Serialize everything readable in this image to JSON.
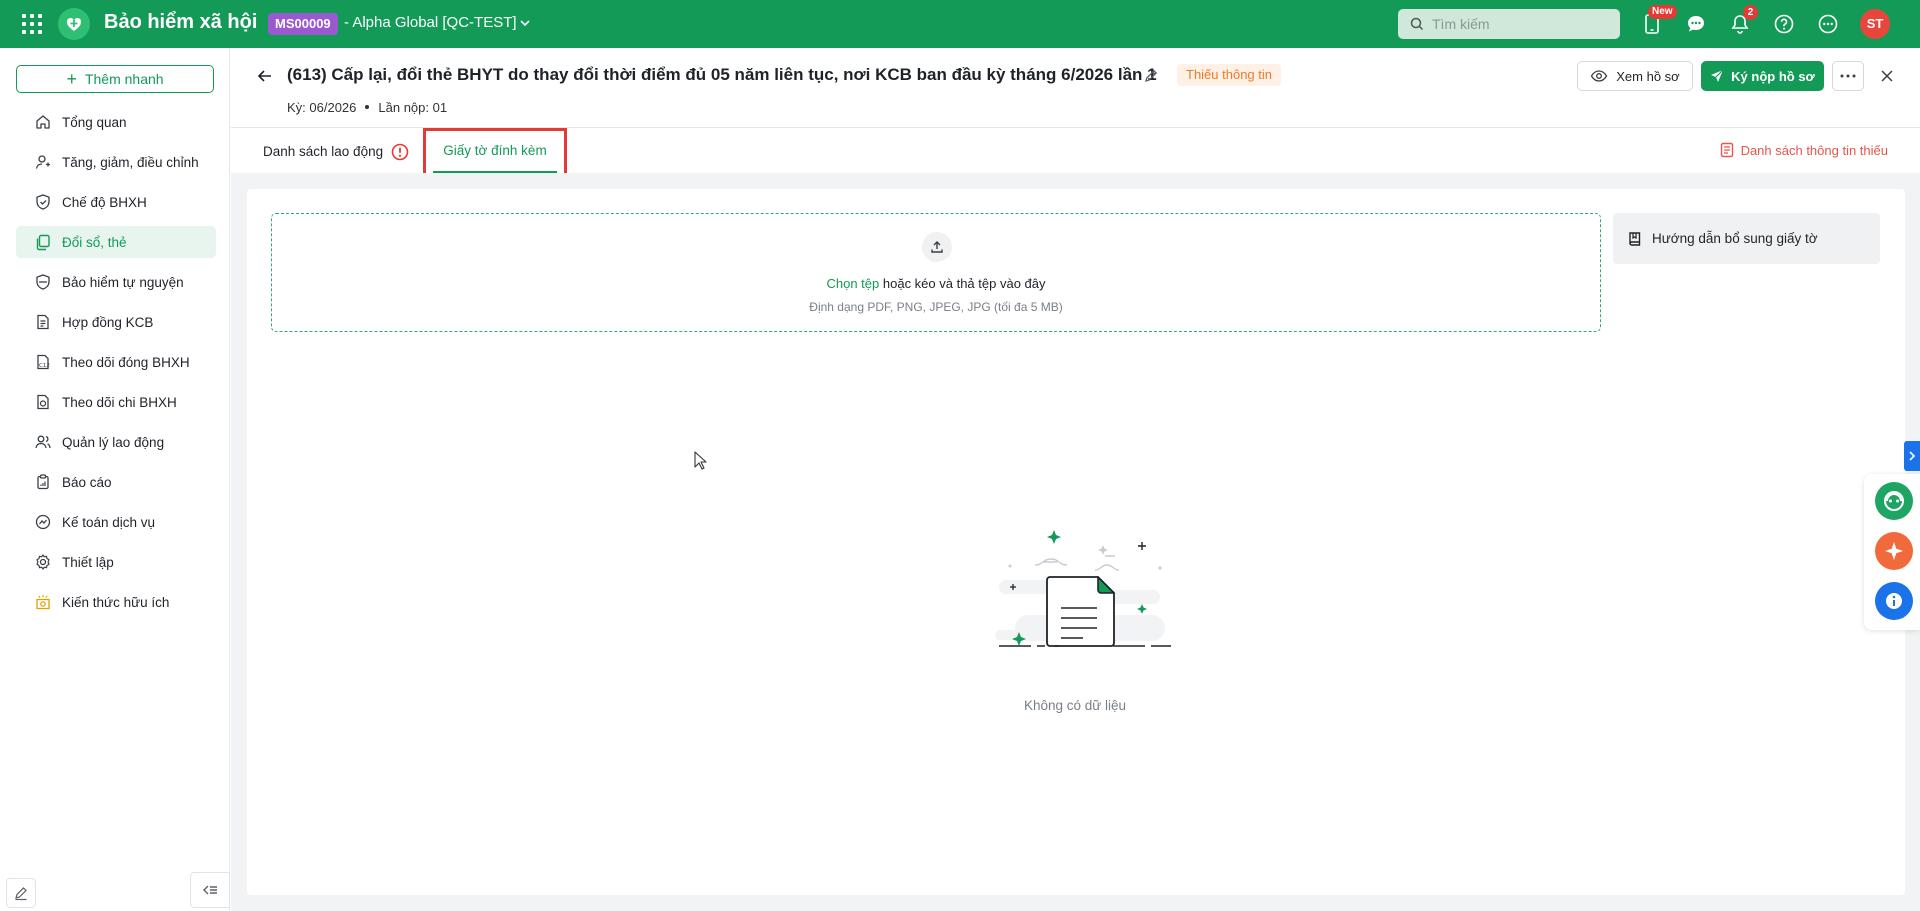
{
  "topbar": {
    "app_title": "Bảo hiểm xã hội",
    "org_code": "MS00009",
    "org_name": "- Alpha Global [QC-TEST]",
    "search_placeholder": "Tìm kiếm",
    "new_badge": "New",
    "notification_count": "2",
    "avatar_initials": "ST"
  },
  "sidebar": {
    "quick_add_label": "Thêm nhanh",
    "items": [
      {
        "label": "Tổng quan",
        "icon": "home-icon"
      },
      {
        "label": "Tăng, giảm, điều chỉnh",
        "icon": "user-adjust-icon"
      },
      {
        "label": "Chế độ BHXH",
        "icon": "shield-check-icon"
      },
      {
        "label": "Đổi sổ, thẻ",
        "icon": "card-copy-icon",
        "active": true
      },
      {
        "label": "Bảo hiểm tự nguyện",
        "icon": "shield-icon"
      },
      {
        "label": "Hợp đồng KCB",
        "icon": "contract-icon"
      },
      {
        "label": "Theo dõi đóng BHXH",
        "icon": "c12-doc-icon"
      },
      {
        "label": "Theo dõi chi BHXH",
        "icon": "doc-money-icon"
      },
      {
        "label": "Quản lý lao động",
        "icon": "users-icon"
      },
      {
        "label": "Báo cáo",
        "icon": "clipboard-icon"
      },
      {
        "label": "Kế toán dịch vụ",
        "icon": "accounting-icon"
      },
      {
        "label": "Thiết lập",
        "icon": "gear-icon"
      },
      {
        "label": "Kiến thức hữu ích",
        "icon": "knowledge-icon"
      }
    ]
  },
  "header": {
    "title": "(613) Cấp lại, đổi thẻ BHYT do thay đổi thời điểm đủ 05 năm liên tục, nơi KCB ban đầu kỳ tháng 6/2026 lần 1",
    "status": "Thiếu thông tin",
    "period": "Kỳ: 06/2026",
    "submission": "Lần nộp: 01",
    "view_label": "Xem hồ sơ",
    "submit_label": "Ký nộp hồ sơ"
  },
  "tabs": {
    "labor_list": "Danh sách lao động",
    "attachments": "Giấy tờ đính kèm",
    "missing_info": "Danh sách thông tin thiếu"
  },
  "upload": {
    "choose_file": "Chọn tệp",
    "drag_text": "hoặc kéo và thả tệp vào đây",
    "formats": "Định dạng PDF, PNG, JPEG, JPG (tối đa 5 MB)"
  },
  "guide": {
    "label": "Hướng dẫn bổ sung giấy tờ"
  },
  "empty_state": {
    "text": "Không có dữ liệu"
  },
  "colors": {
    "brand": "#139a57",
    "warning": "#f07a2a",
    "danger": "#e53935",
    "info": "#1a73e8"
  }
}
